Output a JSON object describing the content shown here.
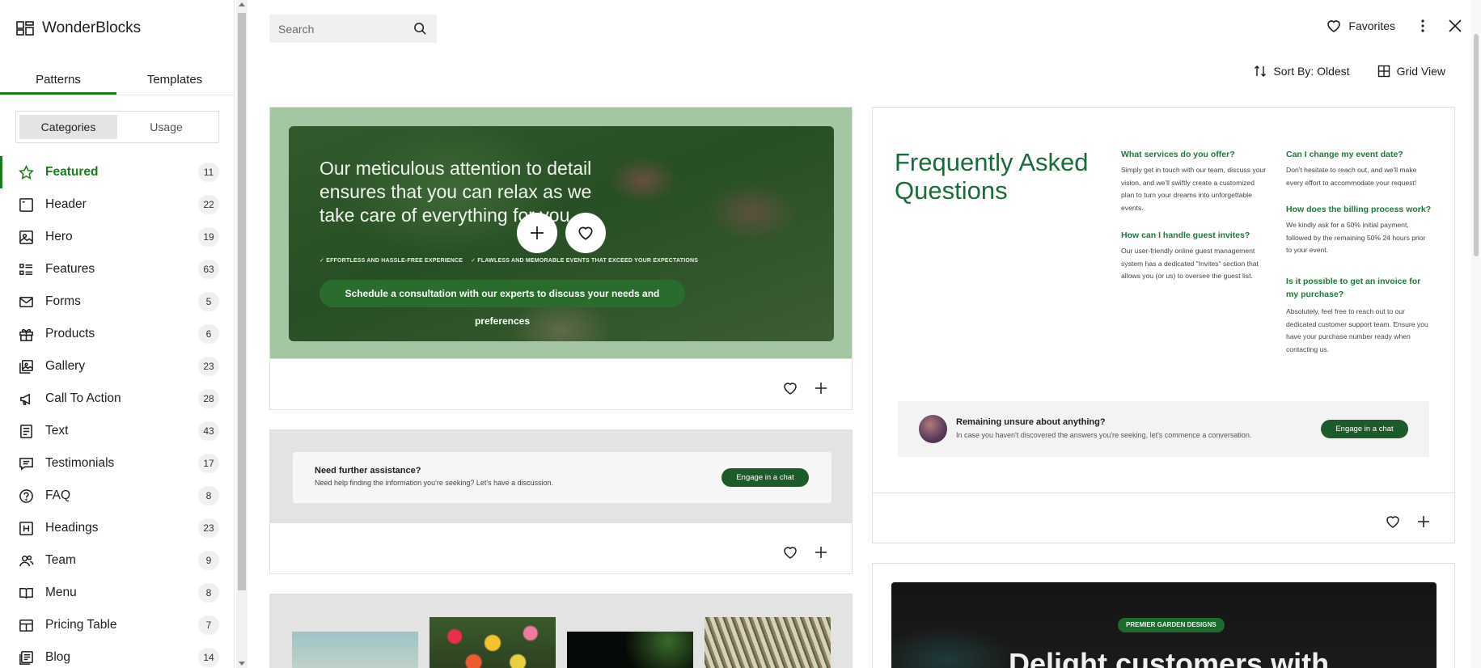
{
  "brand": {
    "name": "WonderBlocks"
  },
  "tabs": [
    {
      "label": "Patterns"
    },
    {
      "label": "Templates"
    }
  ],
  "filters": [
    {
      "label": "Categories"
    },
    {
      "label": "Usage"
    }
  ],
  "categories": [
    {
      "label": "Featured",
      "count": "11",
      "icon": "star-icon"
    },
    {
      "label": "Header",
      "count": "22",
      "icon": "header-icon"
    },
    {
      "label": "Hero",
      "count": "19",
      "icon": "image-icon"
    },
    {
      "label": "Features",
      "count": "63",
      "icon": "list-icon"
    },
    {
      "label": "Forms",
      "count": "5",
      "icon": "mail-icon"
    },
    {
      "label": "Products",
      "count": "6",
      "icon": "gift-icon"
    },
    {
      "label": "Gallery",
      "count": "23",
      "icon": "gallery-icon"
    },
    {
      "label": "Call To Action",
      "count": "28",
      "icon": "megaphone-icon"
    },
    {
      "label": "Text",
      "count": "43",
      "icon": "text-icon"
    },
    {
      "label": "Testimonials",
      "count": "17",
      "icon": "comment-icon"
    },
    {
      "label": "FAQ",
      "count": "8",
      "icon": "help-icon"
    },
    {
      "label": "Headings",
      "count": "23",
      "icon": "heading-icon"
    },
    {
      "label": "Team",
      "count": "9",
      "icon": "people-icon"
    },
    {
      "label": "Menu",
      "count": "8",
      "icon": "book-icon"
    },
    {
      "label": "Pricing Table",
      "count": "7",
      "icon": "table-icon"
    },
    {
      "label": "Blog",
      "count": "14",
      "icon": "blog-icon"
    }
  ],
  "search": {
    "placeholder": "Search"
  },
  "header": {
    "favorites_label": "Favorites"
  },
  "toolbar": {
    "sort_label": "Sort By: Oldest",
    "view_label": "Grid View"
  },
  "cards": {
    "hero": {
      "title": "Our meticulous attention to detail ensures that you can relax as we take care of everything for you.",
      "check1": "✓ EFFORTLESS AND HASSLE-FREE EXPERIENCE",
      "check2": "✓ FLAWLESS AND MEMORABLE EVENTS THAT EXCEED YOUR EXPECTATIONS",
      "cta": "Schedule a consultation with our experts to discuss your needs and preferences"
    },
    "assist": {
      "title": "Need further assistance?",
      "text": "Need help finding the information you're seeking? Let's have a discussion.",
      "button": "Engage in a chat"
    },
    "faq": {
      "title": "Frequently Asked Questions",
      "items": [
        {
          "q": "What services do you offer?",
          "a": "Simply get in touch with our team, discuss your vision, and we'll swiftly create a customized plan to turn your dreams into unforgettable events."
        },
        {
          "q": "How can I handle guest invites?",
          "a": "Our user-friendly online guest management system has a dedicated \"Invites\" section that allows you (or us) to oversee the guest list."
        },
        {
          "q": "Can I change my event date?",
          "a": "Don't hesitate to reach out, and we'll make every effort to accommodate your request!"
        },
        {
          "q": "How does the billing process work?",
          "a": "We kindly ask for a 50% initial payment, followed by the remaining 50% 24 hours prior to your event."
        },
        {
          "q": "Is it possible to get an invoice for my purchase?",
          "a": "Absolutely, feel free to reach out to our dedicated customer support team. Ensure you have your purchase number ready when contacting us."
        }
      ],
      "banner_title": "Remaining unsure about anything?",
      "banner_text": "In case you haven't discovered the answers you're seeking, let's commence a conversation.",
      "banner_button": "Engage in a chat"
    },
    "garden": {
      "pill": "PREMIER GARDEN DESIGNS",
      "title": "Delight customers with"
    }
  },
  "colors": {
    "accent": "#1e7a1e",
    "button_dark_green": "#1e5b2a",
    "faq_green": "#1a6b3a"
  }
}
